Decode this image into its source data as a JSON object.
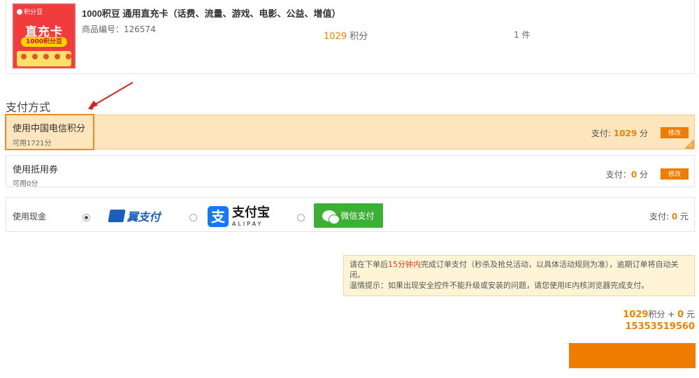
{
  "product": {
    "thumb_brand": "积分豆",
    "thumb_main": "直充卡",
    "thumb_sub": "1000积分豆",
    "title": "1000积豆 通用直充卡（话费、流量、游戏、电影、公益、增值）",
    "code_label": "商品编号：",
    "code_value": "126574",
    "price_value": "1029",
    "price_unit": "积分",
    "quantity": "1 件"
  },
  "payment": {
    "section_title": "支付方式",
    "points": {
      "name": "使用中国电信积分",
      "available": "可用1721分",
      "pay_label": "支付: ",
      "pay_value": "1029",
      "pay_unit": " 分",
      "edit_label": "修改"
    },
    "coupon": {
      "name": "使用抵用券",
      "available": "可用0分",
      "pay_label": "支付：",
      "pay_value": "0",
      "pay_unit": " 分",
      "edit_label": "修改"
    },
    "cash": {
      "name": "使用现金",
      "yipay_label": "翼支付",
      "alipay_cn": "支付宝",
      "alipay_en": "ALIPAY",
      "alipay_mark": "支",
      "wechat_label": "微信支付",
      "pay_label": "支付: ",
      "pay_value": "0",
      "pay_unit": " 元",
      "selected": "yipay"
    }
  },
  "notice": {
    "line1_pre": "请在下单后",
    "line1_red": "15分钟内",
    "line1_post": "完成订单支付（秒杀及抢兑活动，以具体活动规则为准），逾期订单将自动关闭。",
    "line2": "温情提示：如果出现安全控件不能升级或安装的问题，请您使用IE内核浏览器完成支付。"
  },
  "summary": {
    "points_value": "1029",
    "points_unit": "积分 + ",
    "cash_value": "0",
    "cash_unit": " 元",
    "phone_value": "15353519560"
  },
  "colors": {
    "accent": "#f07d00",
    "selected_bg": "#fde6bd",
    "notice_bg": "#fff5d6"
  }
}
